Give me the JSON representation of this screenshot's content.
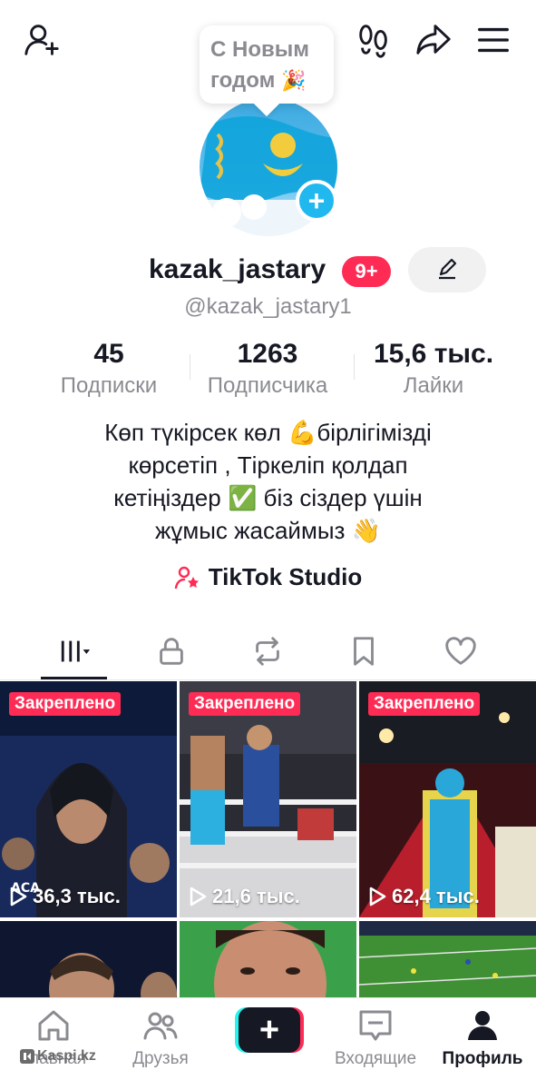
{
  "header": {
    "add_friend_icon": "person-add-icon",
    "footprints_icon": "footprints-icon",
    "share_icon": "share-icon",
    "menu_icon": "hamburger-menu-icon"
  },
  "bubble": {
    "line1": "С Новым",
    "line2": "годом",
    "emoji": "🎉"
  },
  "profile": {
    "username": "kazak_jastary",
    "notif_badge": "9+",
    "handle": "@kazak_jastary1",
    "edit_icon": "pencil-icon"
  },
  "stats": [
    {
      "value": "45",
      "label": "Подписки"
    },
    {
      "value": "1263",
      "label": "Подписчика"
    },
    {
      "value": "15,6 тыс.",
      "label": "Лайки"
    }
  ],
  "bio": {
    "line1": "Көп түкірсек көл 💪бірлігімізді",
    "line2": "көрсетіп , Тіркеліп қолдап",
    "line3": "кетіңіздер ✅  біз сіздер үшін",
    "line4": "жұмыс жасаймыз 👋"
  },
  "studio": {
    "label": "TikTok Studio"
  },
  "tabs": [
    "videos-grid-icon",
    "lock-icon",
    "repost-icon",
    "bookmark-icon",
    "heart-icon"
  ],
  "videos": [
    {
      "pinned": "Закреплено",
      "views": "36,3 тыс."
    },
    {
      "pinned": "Закреплено",
      "views": "21,6 тыс."
    },
    {
      "pinned": "Закреплено",
      "views": "62,4 тыс."
    }
  ],
  "nav": {
    "home": "Главная",
    "friends": "Друзья",
    "create": "+",
    "inbox": "Входящие",
    "profile": "Профиль"
  },
  "watermark": "Kaspi.kz",
  "colors": {
    "accent": "#fe2c55",
    "cyan": "#25f4ee",
    "text": "#161823",
    "muted": "#8a8b91"
  }
}
